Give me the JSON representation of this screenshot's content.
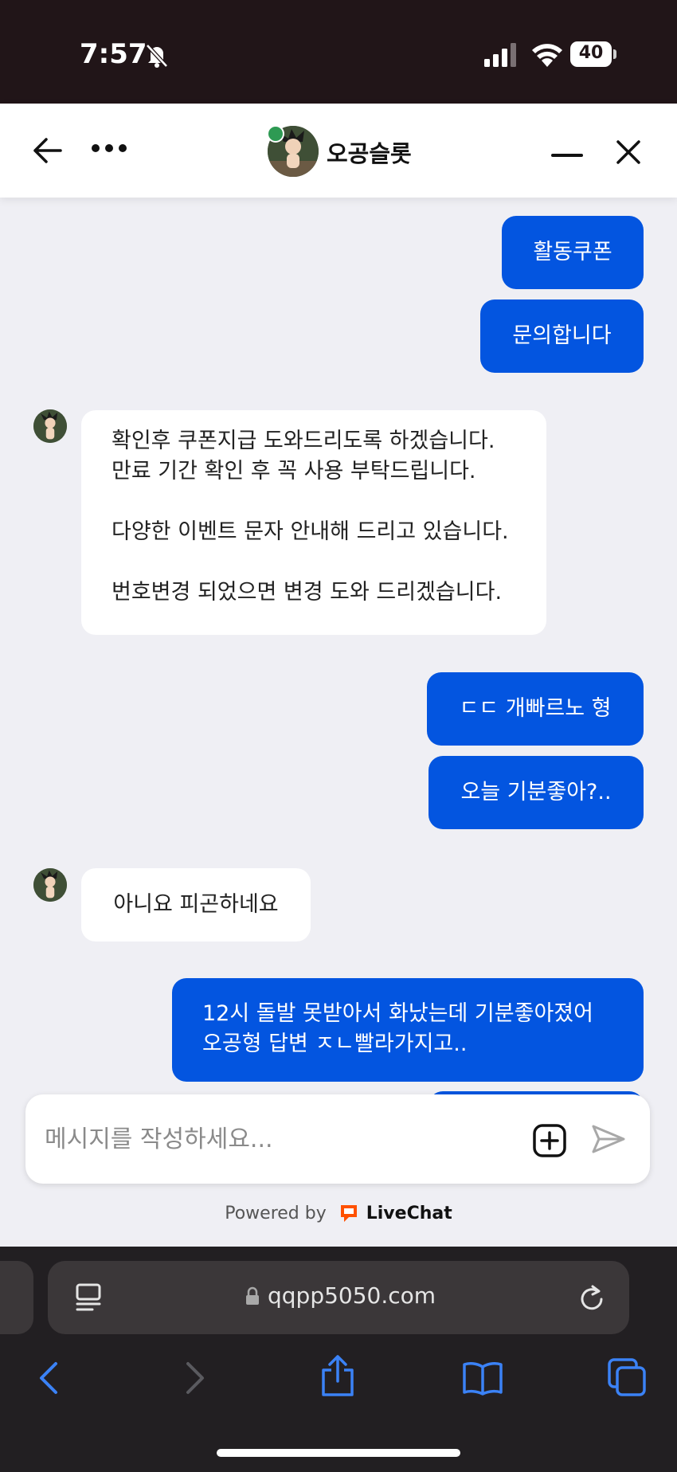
{
  "status_bar": {
    "time": "7:57",
    "battery": "40"
  },
  "header": {
    "title": "오공슬롯",
    "online": true
  },
  "messages": [
    {
      "sender": "user",
      "text": "활동쿠폰"
    },
    {
      "sender": "user",
      "text": "문의합니다"
    },
    {
      "sender": "agent",
      "lines": [
        "확인후 쿠폰지급 도와드리도록 하겠습니다.",
        "만료 기간 확인 후 꼭 사용 부탁드립니다.",
        "",
        "다양한 이벤트 문자 안내해 드리고 있습니다.",
        "",
        "번호변경 되었으면 변경 도와 드리겠습니다."
      ]
    },
    {
      "sender": "user",
      "text": "ㄷㄷ 개빠르노 형"
    },
    {
      "sender": "user",
      "text": "오늘 기분좋아?.."
    },
    {
      "sender": "agent",
      "text": "아니요 피곤하네요"
    },
    {
      "sender": "user",
      "lines": [
        "12시 돌발 못받아서 화났는데 기분좋아졌어",
        "오공형 답변 ㅈㄴ빨라가지고.."
      ]
    }
  ],
  "composer": {
    "placeholder": "메시지를 작성하세요..."
  },
  "powered_by": {
    "prefix": "Powered by",
    "brand": "LiveChat"
  },
  "browser": {
    "url": "qqpp5050.com"
  },
  "colors": {
    "accent": "#0355e0",
    "chat_bg": "#efeff4",
    "status_bg": "#211518",
    "browser_bg": "#221f22",
    "ios_link": "#3b82f6",
    "livechat_orange": "#ff5100"
  },
  "icons": [
    "back-arrow-icon",
    "more-dots-icon",
    "minimize-icon",
    "close-icon",
    "attach-plus-icon",
    "send-icon",
    "reader-icon",
    "lock-icon",
    "reload-icon",
    "nav-back-icon",
    "nav-forward-icon",
    "share-icon",
    "bookmarks-icon",
    "tabs-icon"
  ]
}
